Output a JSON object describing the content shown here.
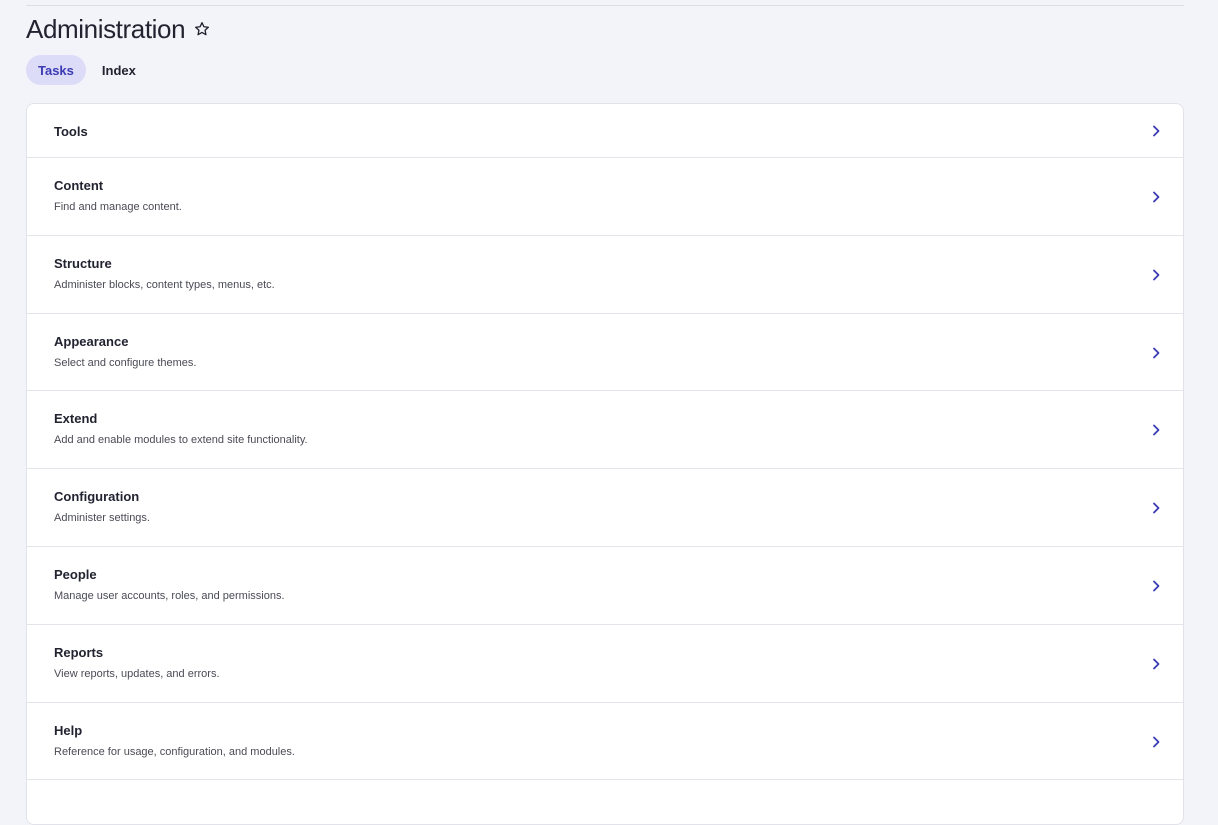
{
  "header": {
    "title": "Administration",
    "favorite_icon": "star-outline-icon"
  },
  "tabs": [
    {
      "label": "Tasks",
      "active": true
    },
    {
      "label": "Index",
      "active": false
    }
  ],
  "items": [
    {
      "title": "Tools",
      "description": ""
    },
    {
      "title": "Content",
      "description": "Find and manage content."
    },
    {
      "title": "Structure",
      "description": "Administer blocks, content types, menus, etc."
    },
    {
      "title": "Appearance",
      "description": "Select and configure themes."
    },
    {
      "title": "Extend",
      "description": "Add and enable modules to extend site functionality."
    },
    {
      "title": "Configuration",
      "description": "Administer settings."
    },
    {
      "title": "People",
      "description": "Manage user accounts, roles, and permissions."
    },
    {
      "title": "Reports",
      "description": "View reports, updates, and errors."
    },
    {
      "title": "Help",
      "description": "Reference for usage, configuration, and modules."
    }
  ],
  "colors": {
    "accent": "#3b3bb3",
    "tab_active_bg": "#dcdcf8",
    "background": "#f3f4f9"
  }
}
